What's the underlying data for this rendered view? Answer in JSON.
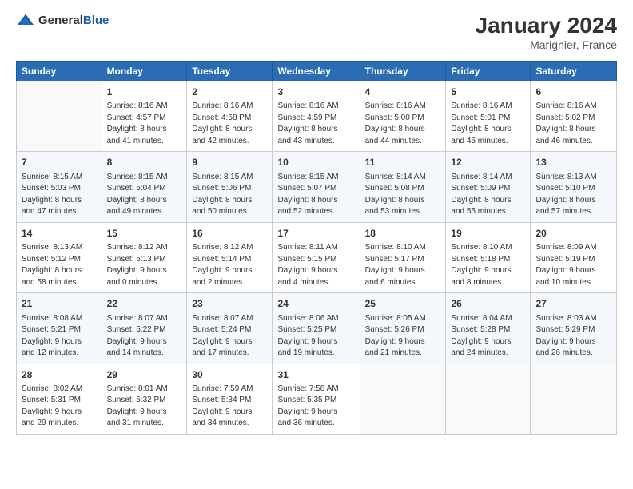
{
  "header": {
    "logo_general": "General",
    "logo_blue": "Blue",
    "title": "January 2024",
    "subtitle": "Marignier, France"
  },
  "columns": [
    "Sunday",
    "Monday",
    "Tuesday",
    "Wednesday",
    "Thursday",
    "Friday",
    "Saturday"
  ],
  "weeks": [
    [
      {
        "day": "",
        "info": ""
      },
      {
        "day": "1",
        "info": "Sunrise: 8:16 AM\nSunset: 4:57 PM\nDaylight: 8 hours\nand 41 minutes."
      },
      {
        "day": "2",
        "info": "Sunrise: 8:16 AM\nSunset: 4:58 PM\nDaylight: 8 hours\nand 42 minutes."
      },
      {
        "day": "3",
        "info": "Sunrise: 8:16 AM\nSunset: 4:59 PM\nDaylight: 8 hours\nand 43 minutes."
      },
      {
        "day": "4",
        "info": "Sunrise: 8:16 AM\nSunset: 5:00 PM\nDaylight: 8 hours\nand 44 minutes."
      },
      {
        "day": "5",
        "info": "Sunrise: 8:16 AM\nSunset: 5:01 PM\nDaylight: 8 hours\nand 45 minutes."
      },
      {
        "day": "6",
        "info": "Sunrise: 8:16 AM\nSunset: 5:02 PM\nDaylight: 8 hours\nand 46 minutes."
      }
    ],
    [
      {
        "day": "7",
        "info": "Sunrise: 8:15 AM\nSunset: 5:03 PM\nDaylight: 8 hours\nand 47 minutes."
      },
      {
        "day": "8",
        "info": "Sunrise: 8:15 AM\nSunset: 5:04 PM\nDaylight: 8 hours\nand 49 minutes."
      },
      {
        "day": "9",
        "info": "Sunrise: 8:15 AM\nSunset: 5:06 PM\nDaylight: 8 hours\nand 50 minutes."
      },
      {
        "day": "10",
        "info": "Sunrise: 8:15 AM\nSunset: 5:07 PM\nDaylight: 8 hours\nand 52 minutes."
      },
      {
        "day": "11",
        "info": "Sunrise: 8:14 AM\nSunset: 5:08 PM\nDaylight: 8 hours\nand 53 minutes."
      },
      {
        "day": "12",
        "info": "Sunrise: 8:14 AM\nSunset: 5:09 PM\nDaylight: 8 hours\nand 55 minutes."
      },
      {
        "day": "13",
        "info": "Sunrise: 8:13 AM\nSunset: 5:10 PM\nDaylight: 8 hours\nand 57 minutes."
      }
    ],
    [
      {
        "day": "14",
        "info": "Sunrise: 8:13 AM\nSunset: 5:12 PM\nDaylight: 8 hours\nand 58 minutes."
      },
      {
        "day": "15",
        "info": "Sunrise: 8:12 AM\nSunset: 5:13 PM\nDaylight: 9 hours\nand 0 minutes."
      },
      {
        "day": "16",
        "info": "Sunrise: 8:12 AM\nSunset: 5:14 PM\nDaylight: 9 hours\nand 2 minutes."
      },
      {
        "day": "17",
        "info": "Sunrise: 8:11 AM\nSunset: 5:15 PM\nDaylight: 9 hours\nand 4 minutes."
      },
      {
        "day": "18",
        "info": "Sunrise: 8:10 AM\nSunset: 5:17 PM\nDaylight: 9 hours\nand 6 minutes."
      },
      {
        "day": "19",
        "info": "Sunrise: 8:10 AM\nSunset: 5:18 PM\nDaylight: 9 hours\nand 8 minutes."
      },
      {
        "day": "20",
        "info": "Sunrise: 8:09 AM\nSunset: 5:19 PM\nDaylight: 9 hours\nand 10 minutes."
      }
    ],
    [
      {
        "day": "21",
        "info": "Sunrise: 8:08 AM\nSunset: 5:21 PM\nDaylight: 9 hours\nand 12 minutes."
      },
      {
        "day": "22",
        "info": "Sunrise: 8:07 AM\nSunset: 5:22 PM\nDaylight: 9 hours\nand 14 minutes."
      },
      {
        "day": "23",
        "info": "Sunrise: 8:07 AM\nSunset: 5:24 PM\nDaylight: 9 hours\nand 17 minutes."
      },
      {
        "day": "24",
        "info": "Sunrise: 8:06 AM\nSunset: 5:25 PM\nDaylight: 9 hours\nand 19 minutes."
      },
      {
        "day": "25",
        "info": "Sunrise: 8:05 AM\nSunset: 5:26 PM\nDaylight: 9 hours\nand 21 minutes."
      },
      {
        "day": "26",
        "info": "Sunrise: 8:04 AM\nSunset: 5:28 PM\nDaylight: 9 hours\nand 24 minutes."
      },
      {
        "day": "27",
        "info": "Sunrise: 8:03 AM\nSunset: 5:29 PM\nDaylight: 9 hours\nand 26 minutes."
      }
    ],
    [
      {
        "day": "28",
        "info": "Sunrise: 8:02 AM\nSunset: 5:31 PM\nDaylight: 9 hours\nand 29 minutes."
      },
      {
        "day": "29",
        "info": "Sunrise: 8:01 AM\nSunset: 5:32 PM\nDaylight: 9 hours\nand 31 minutes."
      },
      {
        "day": "30",
        "info": "Sunrise: 7:59 AM\nSunset: 5:34 PM\nDaylight: 9 hours\nand 34 minutes."
      },
      {
        "day": "31",
        "info": "Sunrise: 7:58 AM\nSunset: 5:35 PM\nDaylight: 9 hours\nand 36 minutes."
      },
      {
        "day": "",
        "info": ""
      },
      {
        "day": "",
        "info": ""
      },
      {
        "day": "",
        "info": ""
      }
    ]
  ]
}
